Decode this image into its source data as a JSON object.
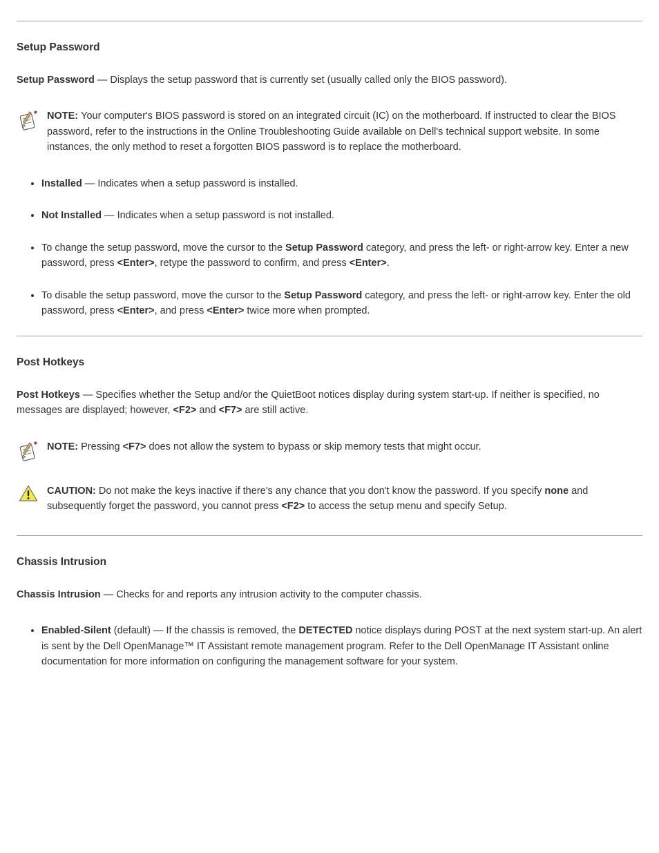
{
  "section1": {
    "heading": "Setup Password",
    "summary_lead": "Setup Password",
    "summary_rest": " — Displays the setup password that is currently set (usually called only the BIOS password).",
    "note_prefix": "NOTE: ",
    "note_text": "Your computer's BIOS password is stored on an integrated circuit (IC) on the motherboard. If instructed to clear the BIOS password, refer to the instructions in the Online Troubleshooting Guide available on Dell's technical support website. In some instances, the only method to reset a forgotten BIOS password is to replace the motherboard.",
    "bullets": [
      {
        "label": "Installed",
        "rest": " — Indicates when a setup password is installed."
      },
      {
        "label": "Not Installed",
        "rest": " — Indicates when a setup password is not installed."
      },
      {
        "lead": "To change the setup password, move the cursor to the ",
        "key1": "Setup Password",
        "mid1": " category, and press the left- or right-arrow key. Enter a new password, press ",
        "key2": "<Enter>",
        "mid2": ", retype the password to confirm, and press ",
        "key3": "<Enter>",
        "tail": "."
      },
      {
        "lead": "To disable the setup password, move the cursor to the ",
        "key1": "Setup Password",
        "mid1": " category, and press the left- or right-arrow key. Enter the old password, press ",
        "key2": "<Enter>",
        "mid2": ", and press ",
        "key3": "<Enter>",
        "tail": " twice more when prompted."
      }
    ]
  },
  "section2": {
    "heading": "Post Hotkeys",
    "summary_lead": "Post Hotkeys",
    "summary_rest": " — Specifies whether the Setup and/or the QuietBoot notices display during system start-up. If neither is specified, no messages are displayed; however, ",
    "summary_key1": "<F2>",
    "summary_mid": " and ",
    "summary_key2": "<F7>",
    "summary_tail": " are still active.",
    "note_prefix": "NOTE: ",
    "note_lead": "Pressing ",
    "note_key": "<F7>",
    "note_rest": " does not allow the system to bypass or skip memory tests that might occur.",
    "caution_prefix": "CAUTION: ",
    "caution_lead": "Do not make the keys inactive if there's any chance that you don't know the password. If you specify ",
    "caution_em": "none",
    "caution_mid": " and subsequently forget the password, you cannot press ",
    "caution_key": "<F2>",
    "caution_tail": " to access the setup menu and specify Setup."
  },
  "section3": {
    "heading": "Chassis Intrusion",
    "summary_lead": "Chassis Intrusion",
    "summary_rest": " — Checks for and reports any intrusion activity to the computer chassis.",
    "bullets": [
      {
        "label": "Enabled-Silent",
        "mid": " (default) — If the chassis is removed, the ",
        "label2": "DETECTED",
        "tail": " notice displays during POST at the next system start-up. An alert is sent by the Dell OpenManage™ IT Assistant remote management program. Refer to the Dell OpenManage IT Assistant online documentation for more information on configuring the management software for your system."
      }
    ]
  }
}
